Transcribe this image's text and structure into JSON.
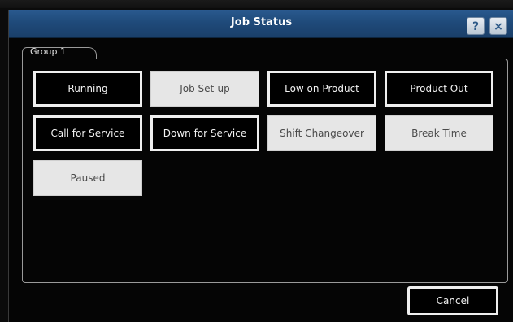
{
  "window": {
    "title": "Job Status",
    "help_label": "?",
    "close_label": "×"
  },
  "group": {
    "tab_label": "Group 1"
  },
  "statuses": [
    {
      "label": "Running",
      "style": "dark"
    },
    {
      "label": "Job Set-up",
      "style": "light"
    },
    {
      "label": "Low on Product",
      "style": "dark"
    },
    {
      "label": "Product Out",
      "style": "dark"
    },
    {
      "label": "Call for Service",
      "style": "dark"
    },
    {
      "label": "Down for Service",
      "style": "dark"
    },
    {
      "label": "Shift Changeover",
      "style": "light"
    },
    {
      "label": "Break Time",
      "style": "light"
    },
    {
      "label": "Paused",
      "style": "light"
    }
  ],
  "footer": {
    "cancel_label": "Cancel"
  }
}
